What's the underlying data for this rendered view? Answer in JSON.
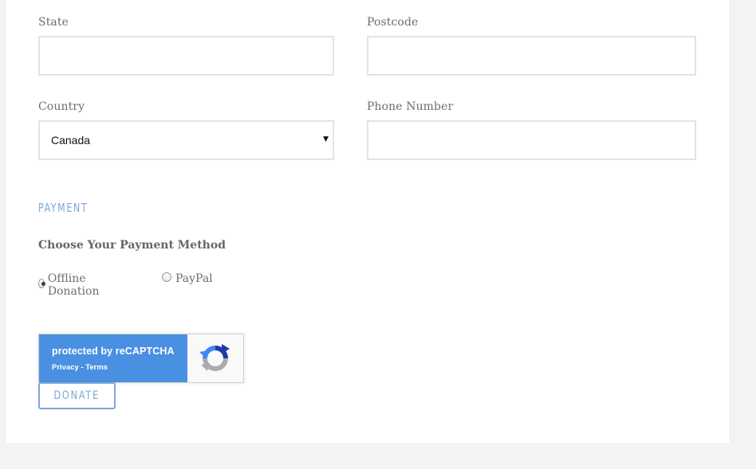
{
  "address": {
    "state": {
      "label": "State",
      "value": ""
    },
    "postcode": {
      "label": "Postcode",
      "value": ""
    },
    "country": {
      "label": "Country",
      "selected": "Canada"
    },
    "phone": {
      "label": "Phone Number",
      "value": ""
    }
  },
  "payment": {
    "heading": "PAYMENT",
    "method_heading": "Choose Your Payment Method",
    "options": [
      {
        "label": "Offline Donation",
        "checked": true
      },
      {
        "label": "PayPal",
        "checked": false
      }
    ]
  },
  "recaptcha": {
    "title": "protected by reCAPTCHA",
    "links": "Privacy - Terms"
  },
  "donate_label": "DONATE",
  "colors": {
    "accent": "#7aa7d9",
    "recaptcha_blue": "#4a90e2",
    "page_bg": "#f3f3f3"
  }
}
